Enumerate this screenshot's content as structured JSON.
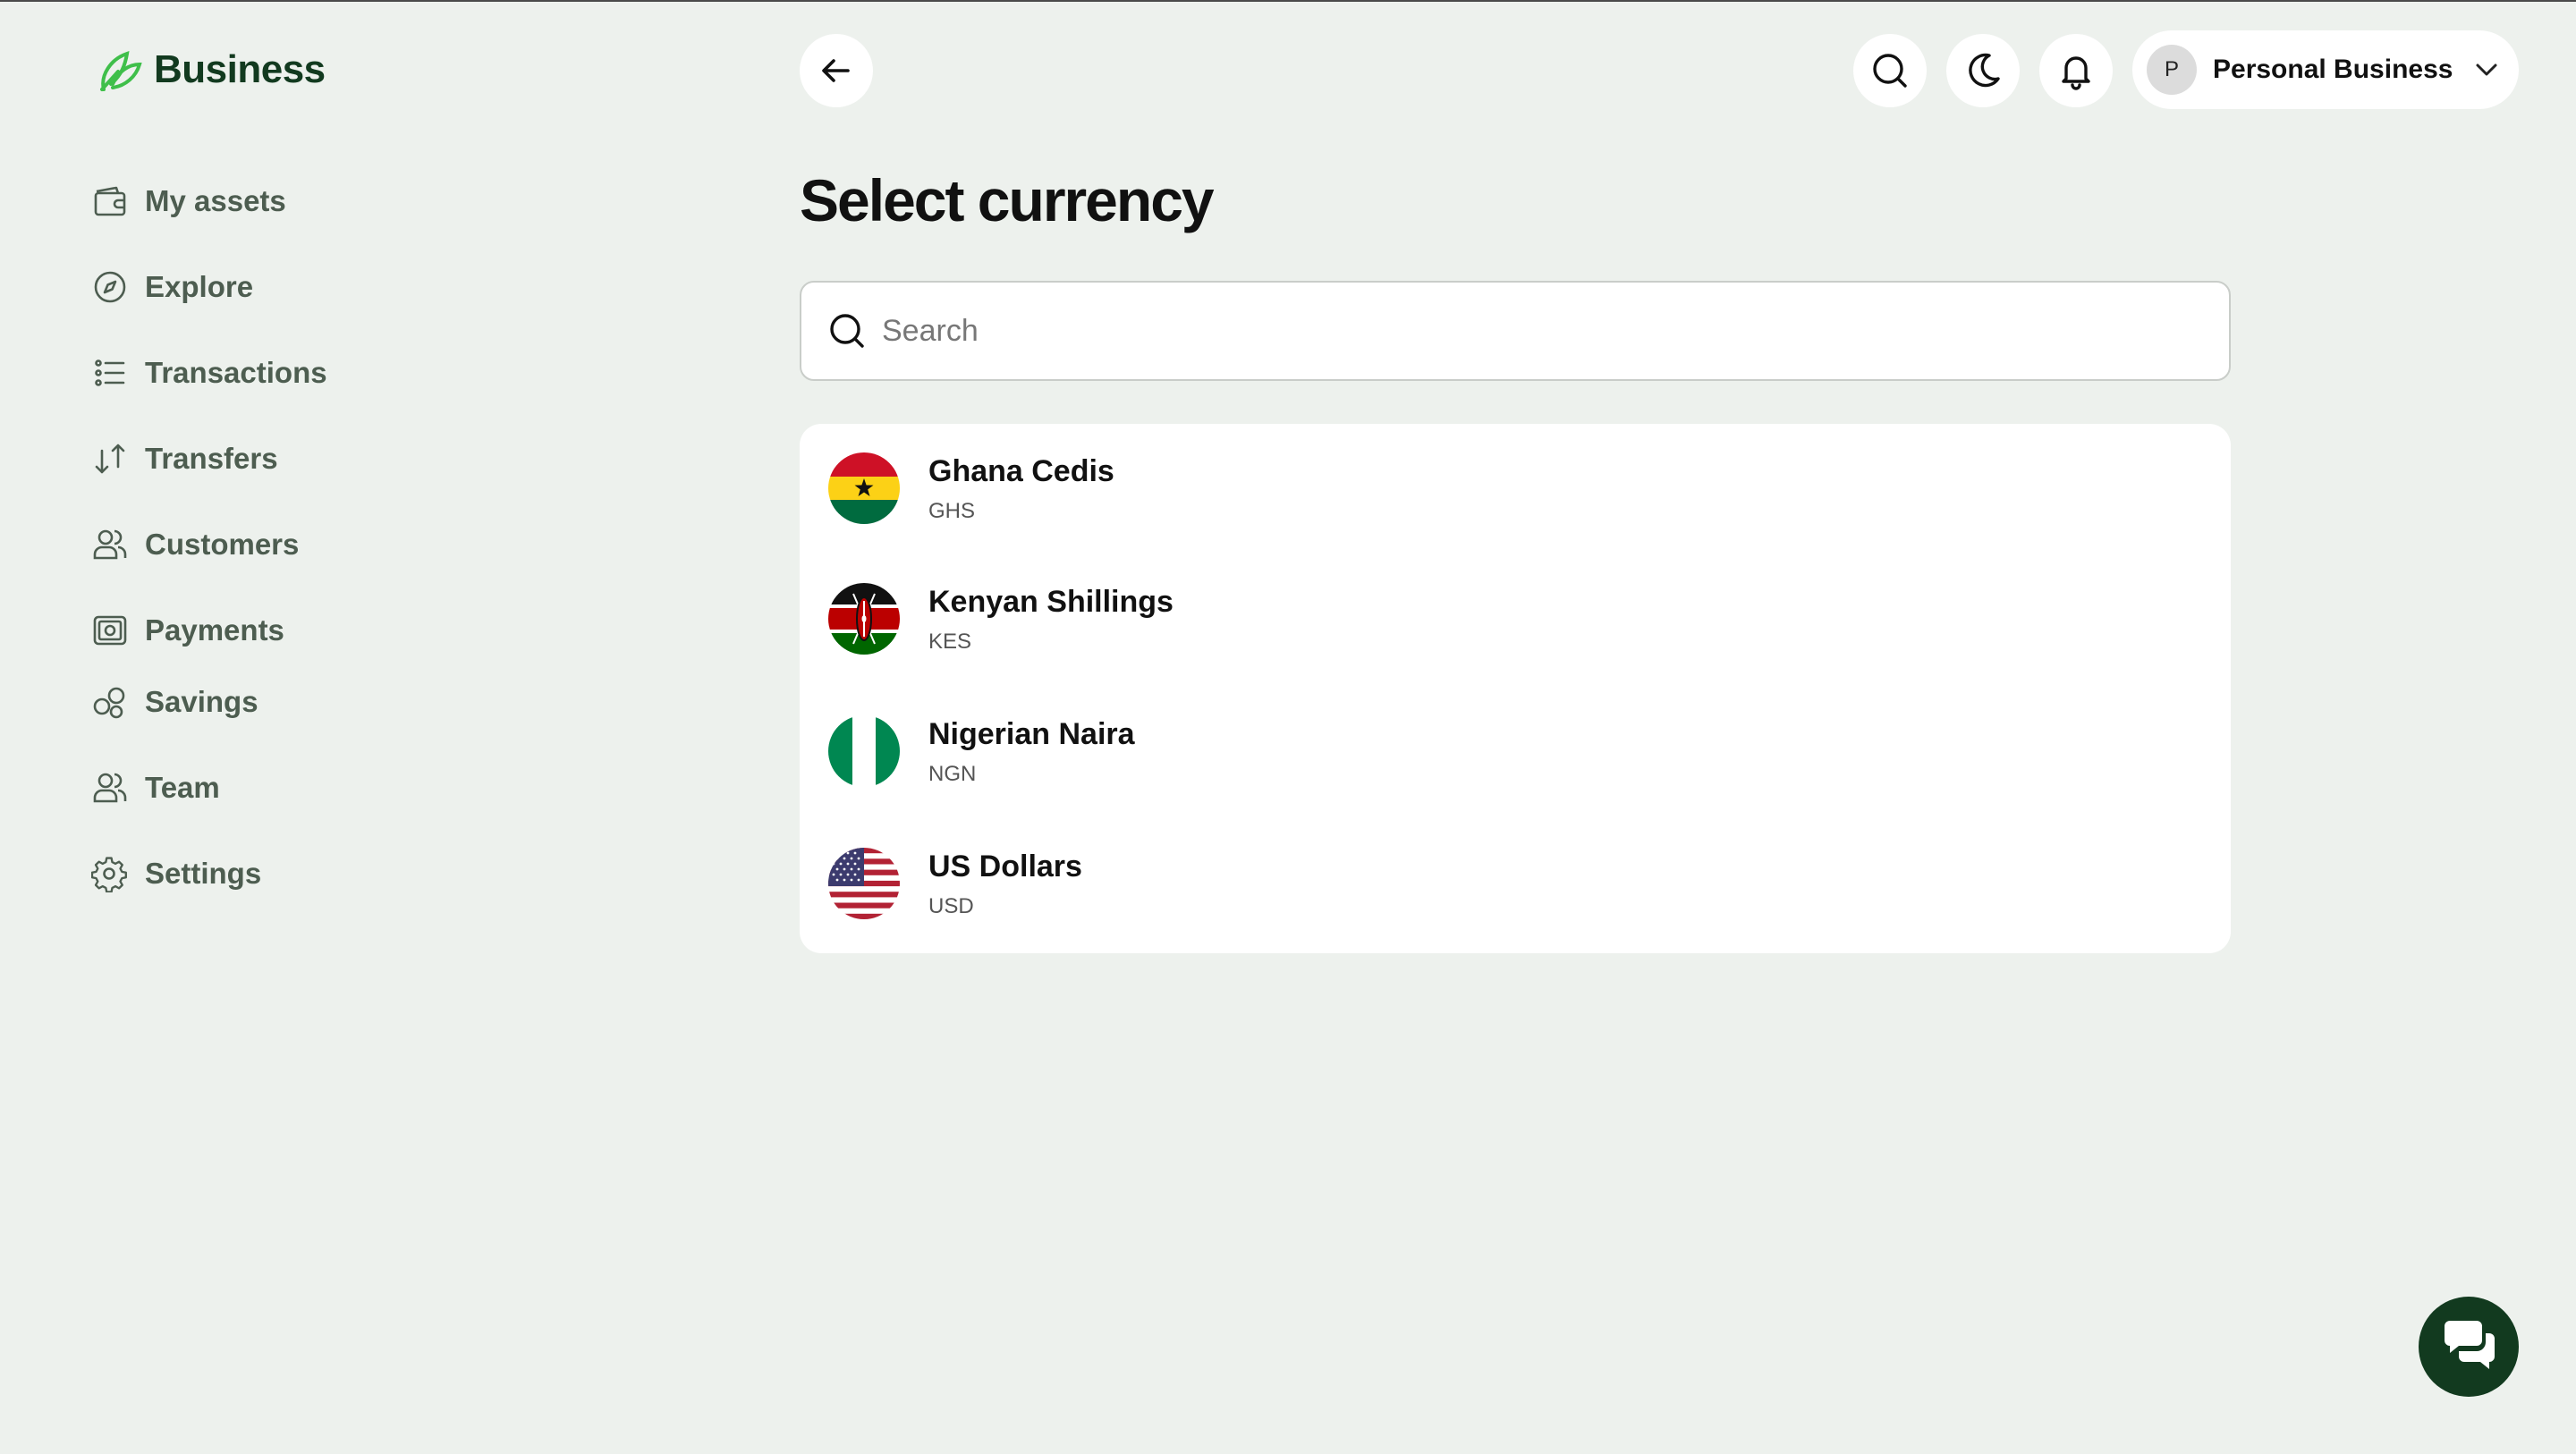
{
  "brand": {
    "name": "Business"
  },
  "sidebar": {
    "items": [
      {
        "label": "My assets",
        "icon": "wallet-icon"
      },
      {
        "label": "Explore",
        "icon": "compass-icon"
      },
      {
        "label": "Transactions",
        "icon": "list-icon"
      },
      {
        "label": "Transfers",
        "icon": "transfer-arrows-icon"
      },
      {
        "label": "Customers",
        "icon": "users-icon"
      },
      {
        "label": "Payments",
        "icon": "payment-icon"
      },
      {
        "label": "Savings",
        "icon": "coins-icon"
      },
      {
        "label": "Team",
        "icon": "team-icon"
      },
      {
        "label": "Settings",
        "icon": "gear-icon"
      }
    ]
  },
  "header": {
    "account_initial": "P",
    "account_name": "Personal Business"
  },
  "main": {
    "title": "Select currency",
    "search": {
      "placeholder": "Search",
      "value": ""
    },
    "currencies": [
      {
        "name": "Ghana Cedis",
        "code": "GHS",
        "flag": "ghana-flag-icon"
      },
      {
        "name": "Kenyan Shillings",
        "code": "KES",
        "flag": "kenya-flag-icon"
      },
      {
        "name": "Nigerian Naira",
        "code": "NGN",
        "flag": "nigeria-flag-icon"
      },
      {
        "name": "US Dollars",
        "code": "USD",
        "flag": "usa-flag-icon"
      }
    ]
  },
  "colors": {
    "background": "#edf1ed",
    "brand_dark": "#123a1f",
    "brand_green": "#3fbf4a",
    "nav_text": "#4d5d50"
  }
}
